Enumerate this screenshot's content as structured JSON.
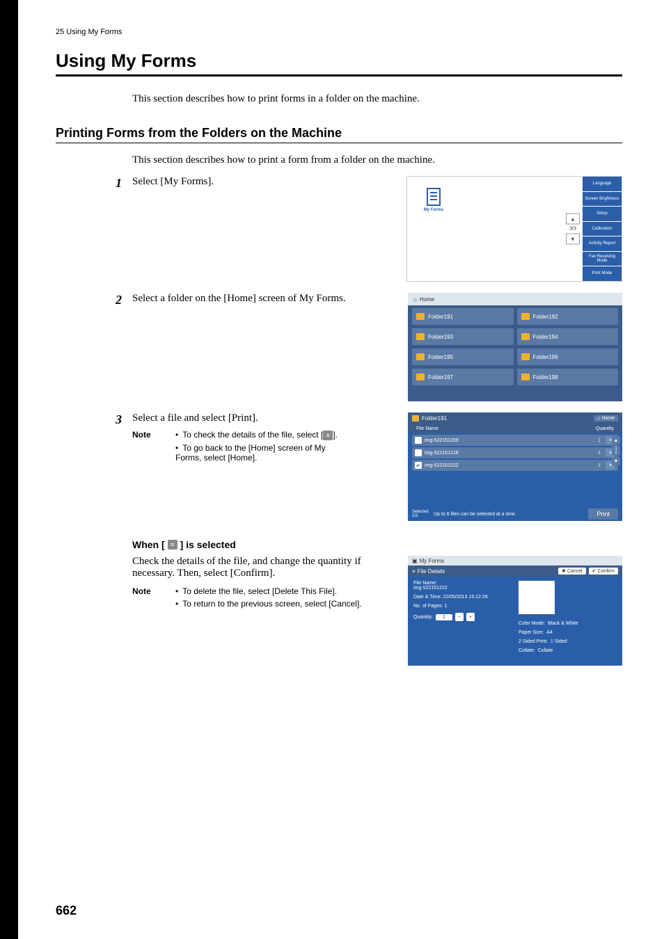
{
  "header": {
    "chapter": "25 Using My Forms"
  },
  "h1": "Using My Forms",
  "intro": "This section describes how to print forms in a folder on the machine.",
  "h2": "Printing Forms from the Folders on the Machine",
  "sub_intro": "This section describes how to print a form from a folder on the machine.",
  "pagenum": "662",
  "steps": {
    "1": {
      "num": "1",
      "text": "Select [My Forms]."
    },
    "2": {
      "num": "2",
      "text": "Select a folder on the [Home] screen of My Forms."
    },
    "3": {
      "num": "3",
      "text": "Select a file and select [Print]."
    }
  },
  "note_label": "Note",
  "note1": {
    "a": "To check the details of the file, select [",
    "b": "].",
    "c": "To go back to the [Home] screen of My Forms, select [Home]."
  },
  "h3_a": "When [",
  "h3_b": "] is selected",
  "h3_body": "Check the details of the file, and change the quantity if necessary. Then, select [Confirm].",
  "note2": {
    "a": "To delete the file, select [Delete This File].",
    "b": "To return to the previous screen, select [Cancel]."
  },
  "ss1": {
    "tile": "My Forms",
    "pg": "3/3",
    "side": [
      "Language",
      "Screen Brightness",
      "Setup",
      "Calibration",
      "Activity Report",
      "Fax Receiving Mode",
      "Print Mode"
    ]
  },
  "ss2": {
    "header": "Home",
    "folders": [
      "Folder191",
      "Folder192",
      "Folder193",
      "Folder194",
      "Folder195",
      "Folder196",
      "Folder197",
      "Folder198"
    ]
  },
  "ss3": {
    "title": "Folder191",
    "home": "Home",
    "col_file": "File Name",
    "col_qty": "Quantity",
    "rows": [
      {
        "name": "img-522151209",
        "qty": "1",
        "sel": false
      },
      {
        "name": "img-522151218",
        "qty": "1",
        "sel": false
      },
      {
        "name": "img-522151222",
        "qty": "1",
        "sel": true
      }
    ],
    "sel_label": "Selected:",
    "sel_count": "1/3",
    "msg": "Up to 6 files can be selected at a time.",
    "print": "Print",
    "page": "1\n1"
  },
  "ss4": {
    "crumb": "My Forms",
    "title": "File Details",
    "cancel": "Cancel",
    "confirm": "Confirm",
    "fn_label": "File Name:",
    "fn": "img-522151222",
    "dt_label": "Date & Time: 22/05/2013 15:12:26",
    "pages": "No. of Pages: 1",
    "qty_label": "Quantity:",
    "qty": "1",
    "cm_label": "Color Mode:",
    "cm": "Black & White",
    "ps_label": "Paper Size:",
    "ps": "A4",
    "sp_label": "2 Sided Print:",
    "sp": "1 Sided",
    "co_label": "Collate:",
    "co": "Collate"
  }
}
